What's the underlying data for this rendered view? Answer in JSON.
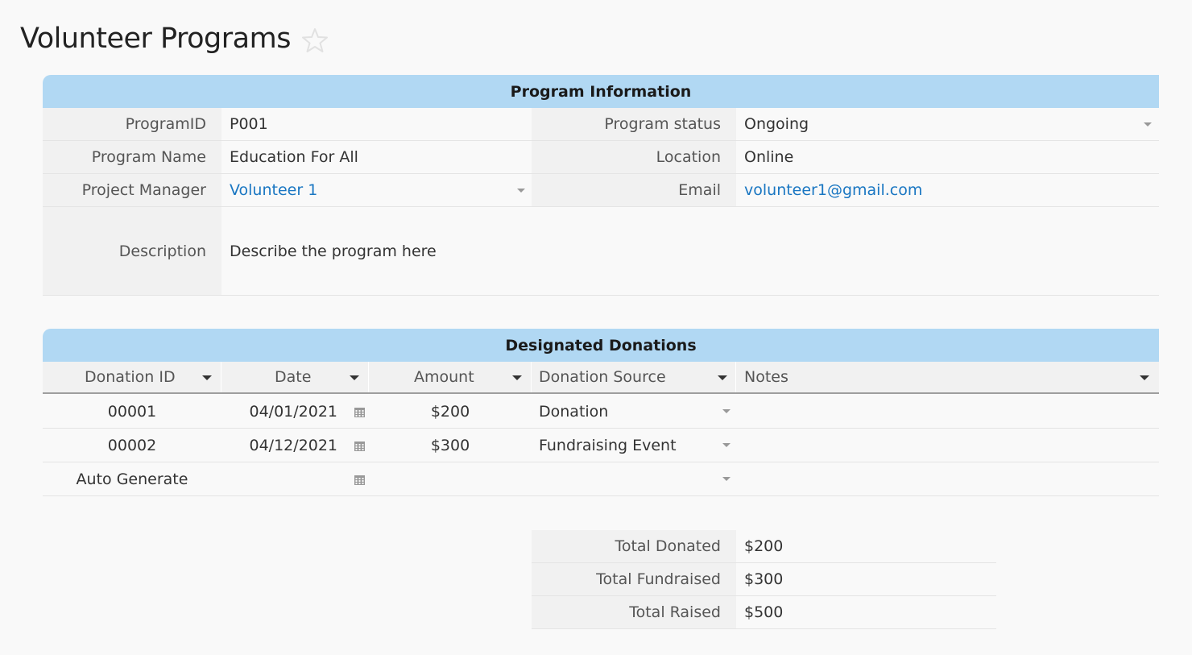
{
  "page": {
    "title": "Volunteer Programs"
  },
  "program_info": {
    "header": "Program Information",
    "program_id_label": "ProgramID",
    "program_id": "P001",
    "program_name_label": "Program Name",
    "program_name": "Education For All",
    "project_manager_label": "Project Manager",
    "project_manager": "Volunteer 1",
    "program_status_label": "Program status",
    "program_status": "Ongoing",
    "location_label": "Location",
    "location": "Online",
    "email_label": "Email",
    "email": "volunteer1@gmail.com",
    "description_label": "Description",
    "description": "Describe the program here"
  },
  "donations": {
    "header": "Designated Donations",
    "columns": [
      "Donation ID",
      "Date",
      "Amount",
      "Donation Source",
      "Notes"
    ],
    "rows": [
      {
        "id": "00001",
        "date": "04/01/2021",
        "amount": "$200",
        "source": "Donation",
        "notes": ""
      },
      {
        "id": "00002",
        "date": "04/12/2021",
        "amount": "$300",
        "source": "Fundraising Event",
        "notes": ""
      }
    ],
    "new_row": {
      "id": "Auto Generate"
    }
  },
  "totals": {
    "donated_label": "Total Donated",
    "donated": "$200",
    "fundraised_label": "Total Fundraised",
    "fundraised": "$300",
    "raised_label": "Total Raised",
    "raised": "$500"
  },
  "colors": {
    "header_bar": "#b1d8f3",
    "link": "#1976c2",
    "label_bg": "#f1f1f1",
    "page_bg": "#f9f9f9"
  },
  "icons": {
    "favorite": "star-icon",
    "date_picker": "calendar-icon",
    "dropdown": "chevron-down-icon"
  }
}
